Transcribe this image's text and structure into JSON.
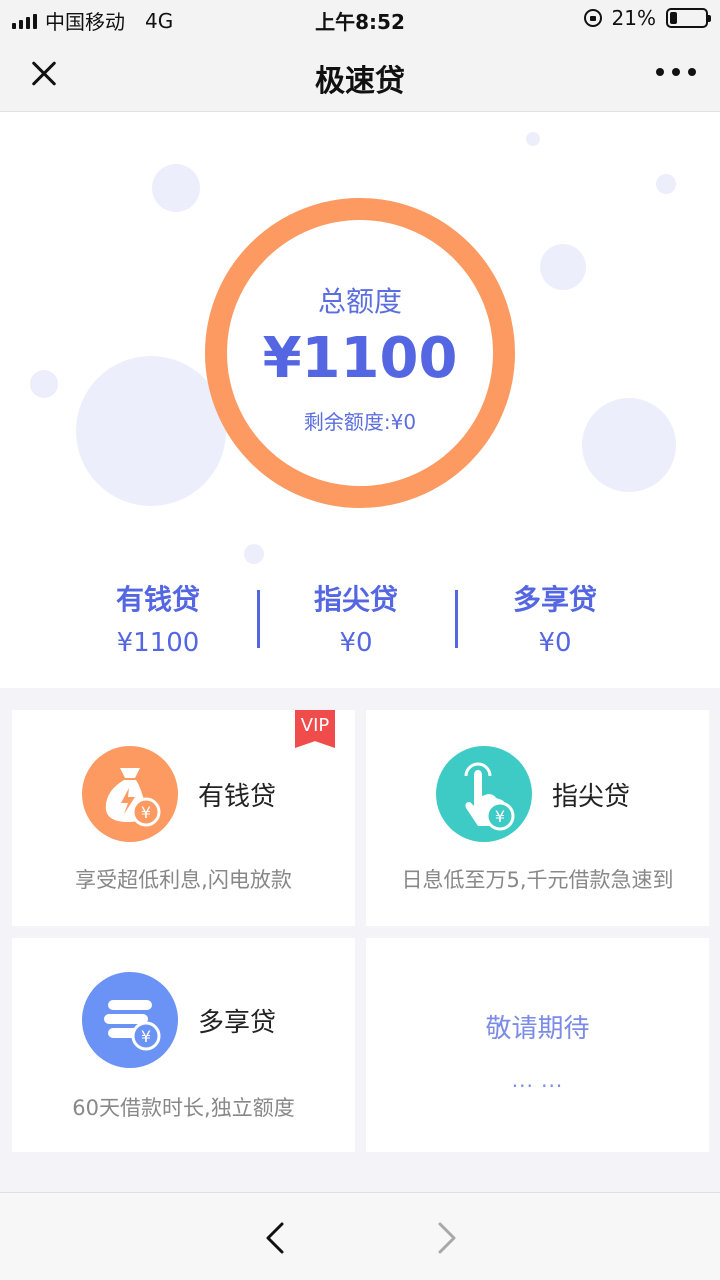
{
  "status_bar": {
    "carrier": "中国移动",
    "network": "4G",
    "time": "上午8:52",
    "battery": "21%"
  },
  "nav": {
    "title": "极速贷"
  },
  "hero": {
    "total_label": "总额度",
    "total_amount": "¥1100",
    "remaining": "剩余额度:¥0",
    "summary": [
      {
        "name": "有钱贷",
        "value": "¥1100"
      },
      {
        "name": "指尖贷",
        "value": "¥0"
      },
      {
        "name": "多享贷",
        "value": "¥0"
      }
    ]
  },
  "cards": [
    {
      "title": "有钱贷",
      "desc": "享受超低利息,闪电放款",
      "badge": "VIP",
      "icon": "money-bag-icon",
      "color": "#fc9a62"
    },
    {
      "title": "指尖贷",
      "desc": "日息低至万5,千元借款急速到",
      "icon": "finger-tap-icon",
      "color": "#3fcbc5"
    },
    {
      "title": "多享贷",
      "desc": "60天借款时长,独立额度",
      "icon": "coin-stack-icon",
      "color": "#6b93f5"
    },
    {
      "title": "敬请期待",
      "dots": "··· ···"
    }
  ],
  "colors": {
    "accent": "#5466e2",
    "ring": "#fc9a62",
    "vip": "#f04c4c"
  }
}
